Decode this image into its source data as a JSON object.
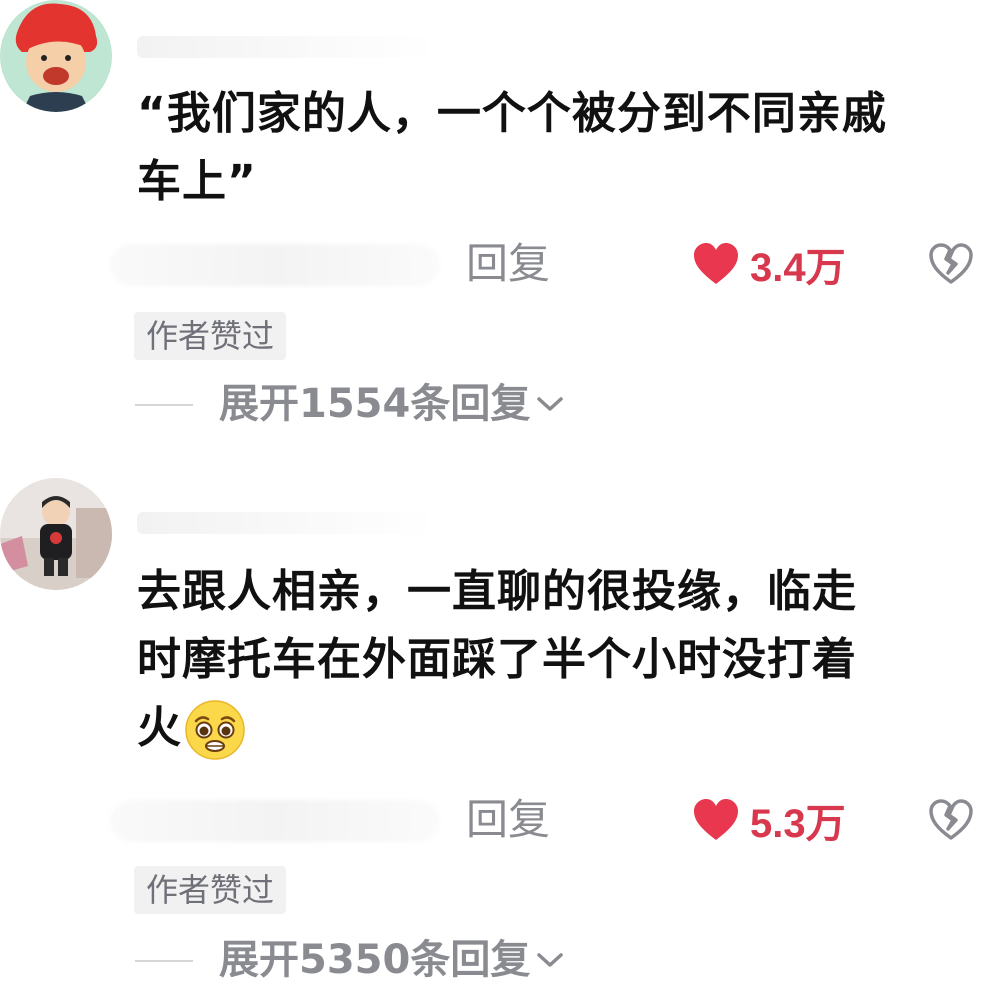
{
  "comments": [
    {
      "text_line1": "“我们家的人，一个个被分到不同亲戚",
      "text_line2": "车上”",
      "reply_label": "回复",
      "like_count": "3.4万",
      "author_badge": "作者赞过",
      "expand_label": "展开1554条回复"
    },
    {
      "text_line1": "去跟人相亲，一直聊的很投缘，临走",
      "text_line2": "时摩托车在外面踩了半个小时没打着",
      "text_line3": "火",
      "reply_label": "回复",
      "like_count": "5.3万",
      "author_badge": "作者赞过",
      "expand_label": "展开5350条回复"
    }
  ],
  "icons": {
    "like": "heart-icon",
    "dislike": "broken-heart-icon",
    "expand": "chevron-down-icon",
    "emoji": "pleading-face-emoji"
  },
  "colors": {
    "like_red": "#d8384d",
    "muted_gray": "#8a8b91",
    "badge_bg": "#f1f1f2"
  }
}
